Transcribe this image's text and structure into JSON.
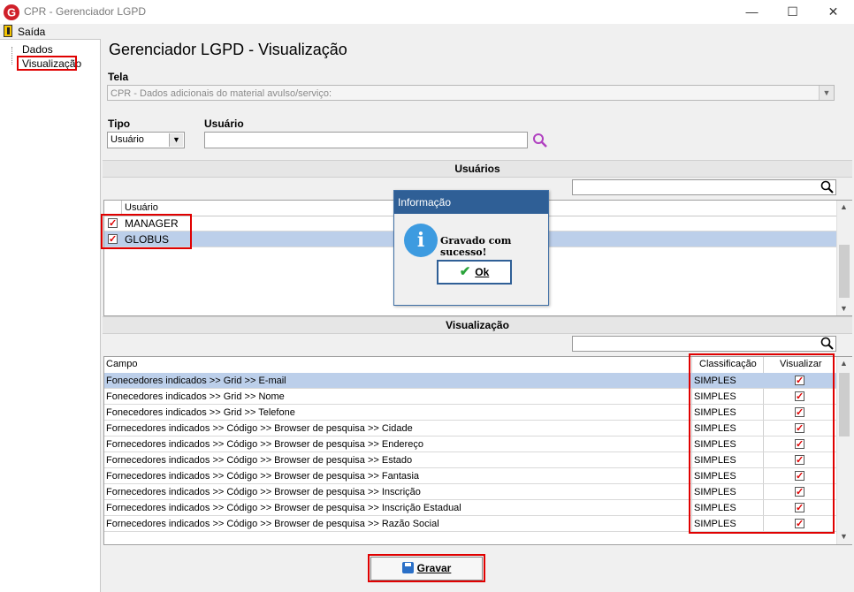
{
  "window": {
    "title": "CPR - Gerenciador LGPD",
    "minimize": "—",
    "maximize": "☐",
    "close": "✕"
  },
  "menu": {
    "exit_label": "Saída"
  },
  "tree": {
    "items": [
      "Dados",
      "Visualização"
    ]
  },
  "page": {
    "title": "Gerenciador LGPD - Visualização"
  },
  "tela": {
    "label": "Tela",
    "value": "CPR - Dados adicionais do material avulso/serviço:"
  },
  "tipo": {
    "label": "Tipo",
    "value": "Usuário"
  },
  "usuario": {
    "label": "Usuário",
    "value": ""
  },
  "users_section": {
    "header": "Usuários",
    "column": "Usuário",
    "rows": [
      {
        "name": "MANAGER",
        "checked": true
      },
      {
        "name": "GLOBUS",
        "checked": true
      }
    ]
  },
  "vis_section": {
    "header": "Visualização",
    "columns": [
      "Campo",
      "Classificação",
      "Visualizar"
    ],
    "rows": [
      {
        "campo": "Fonecedores indicados >> Grid >> E-mail",
        "class": "SIMPLES",
        "vis": true
      },
      {
        "campo": "Fonecedores indicados >> Grid >> Nome",
        "class": "SIMPLES",
        "vis": true
      },
      {
        "campo": "Fonecedores indicados >> Grid >> Telefone",
        "class": "SIMPLES",
        "vis": true
      },
      {
        "campo": "Fornecedores indicados >> Código >> Browser de pesquisa >> Cidade",
        "class": "SIMPLES",
        "vis": true
      },
      {
        "campo": "Fornecedores indicados >> Código >> Browser de pesquisa >> Endereço",
        "class": "SIMPLES",
        "vis": true
      },
      {
        "campo": "Fornecedores indicados >> Código >> Browser de pesquisa >> Estado",
        "class": "SIMPLES",
        "vis": true
      },
      {
        "campo": "Fornecedores indicados >> Código >> Browser de pesquisa >> Fantasia",
        "class": "SIMPLES",
        "vis": true
      },
      {
        "campo": "Fornecedores indicados >> Código >> Browser de pesquisa >> Inscrição",
        "class": "SIMPLES",
        "vis": true
      },
      {
        "campo": "Fornecedores indicados >> Código >> Browser de pesquisa >> Inscrição Estadual",
        "class": "SIMPLES",
        "vis": true
      },
      {
        "campo": "Fornecedores indicados >> Código >> Browser de pesquisa >> Razão Social",
        "class": "SIMPLES",
        "vis": true
      }
    ]
  },
  "dialog": {
    "title": "Informação",
    "message": "Gravado com sucesso!",
    "ok_label": "Ok"
  },
  "footer": {
    "save_label": "Gravar"
  },
  "colors": {
    "highlight": "#e00000",
    "selection": "#bccfea",
    "dialog_title": "#2f5f96"
  }
}
